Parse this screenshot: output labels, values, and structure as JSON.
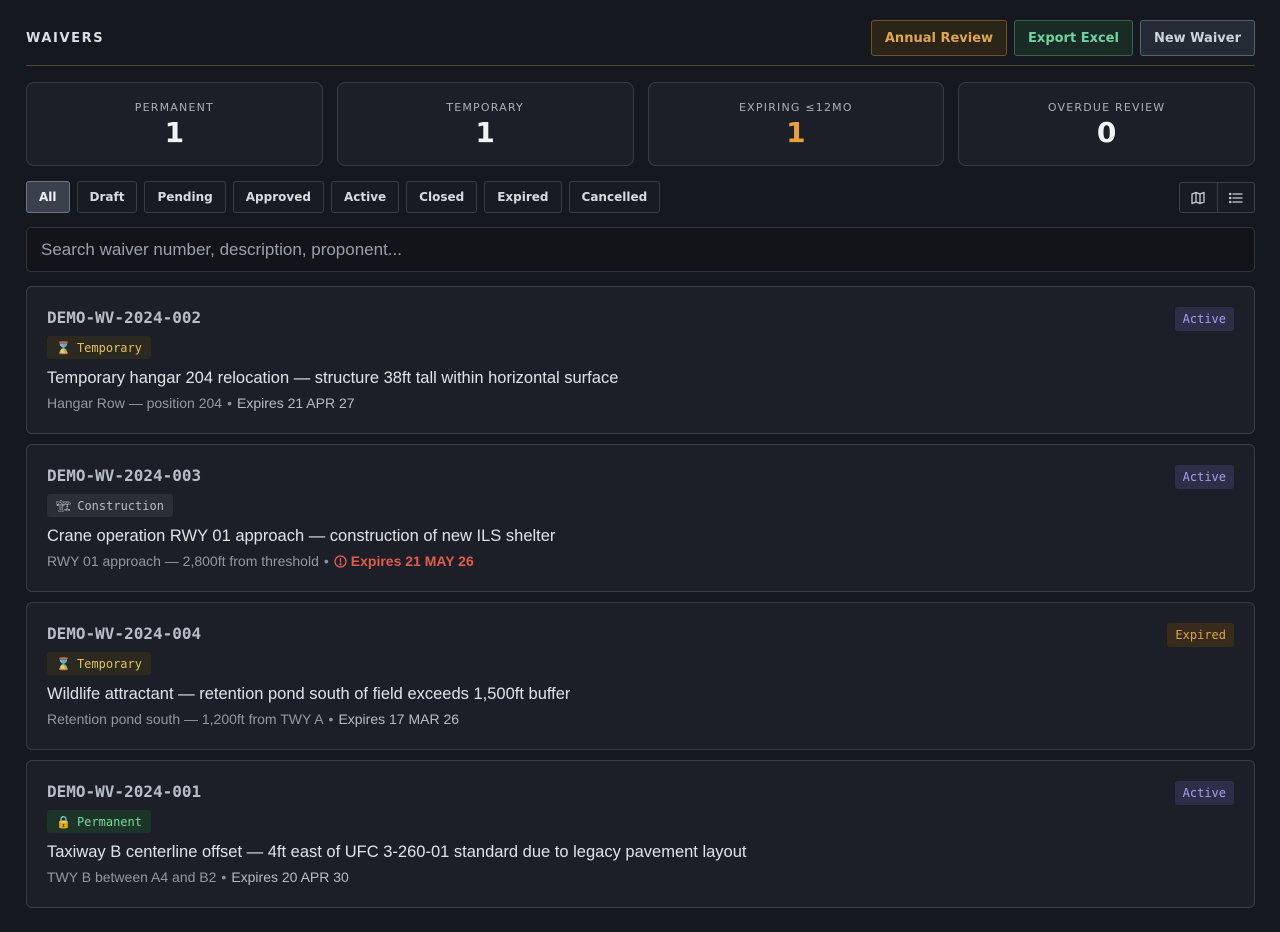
{
  "header": {
    "title": "WAIVERS",
    "actions": {
      "annual_review": "Annual Review",
      "export_excel": "Export Excel",
      "new_waiver": "New Waiver"
    }
  },
  "stats": [
    {
      "label": "PERMANENT",
      "value": "1"
    },
    {
      "label": "TEMPORARY",
      "value": "1"
    },
    {
      "label": "EXPIRING ≤12MO",
      "value": "1"
    },
    {
      "label": "OVERDUE REVIEW",
      "value": "0"
    }
  ],
  "filters": {
    "selected": "All",
    "items": [
      "All",
      "Draft",
      "Pending",
      "Approved",
      "Active",
      "Closed",
      "Expired",
      "Cancelled"
    ]
  },
  "view_toggle": {
    "map_icon": "map-icon",
    "list_icon": "list-icon"
  },
  "search": {
    "placeholder": "Search waiver number, description, proponent...",
    "value": ""
  },
  "colors": {
    "background": "#15181f",
    "accent_warn": "#e9a03a",
    "accent_success": "#6ed4a2",
    "alert": "#e25b4e",
    "status_active": "#a59df0"
  },
  "waivers": [
    {
      "number": "DEMO-WV-2024-002",
      "tag": {
        "icon": "⌛",
        "icon_name": "hourglass-icon",
        "label": "Temporary"
      },
      "description": "Temporary hangar 204 relocation — structure 38ft tall within horizontal surface",
      "location": "Hangar Row — position 204",
      "separator": "•",
      "expires": "Expires 21 APR 27",
      "status": "Active"
    },
    {
      "number": "DEMO-WV-2024-003",
      "tag": {
        "icon": "🏗",
        "icon_name": "crane-icon",
        "label": "Construction"
      },
      "description": "Crane operation RWY 01 approach — construction of new ILS shelter",
      "location": "RWY 01 approach — 2,800ft from threshold",
      "separator": "•",
      "expires": "Expires 21 MAY 26",
      "status": "Active"
    },
    {
      "number": "DEMO-WV-2024-004",
      "tag": {
        "icon": "⌛",
        "icon_name": "hourglass-icon",
        "label": "Temporary"
      },
      "description": "Wildlife attractant — retention pond south of field exceeds 1,500ft buffer",
      "location": "Retention pond south — 1,200ft from TWY A",
      "separator": "•",
      "expires": "Expires 17 MAR 26",
      "status": "Expired"
    },
    {
      "number": "DEMO-WV-2024-001",
      "tag": {
        "icon": "🔒",
        "icon_name": "lock-icon",
        "label": "Permanent"
      },
      "description": "Taxiway B centerline offset — 4ft east of UFC 3-260-01 standard due to legacy pavement layout",
      "location": "TWY B between A4 and B2",
      "separator": "•",
      "expires": "Expires 20 APR 30",
      "status": "Active"
    }
  ]
}
